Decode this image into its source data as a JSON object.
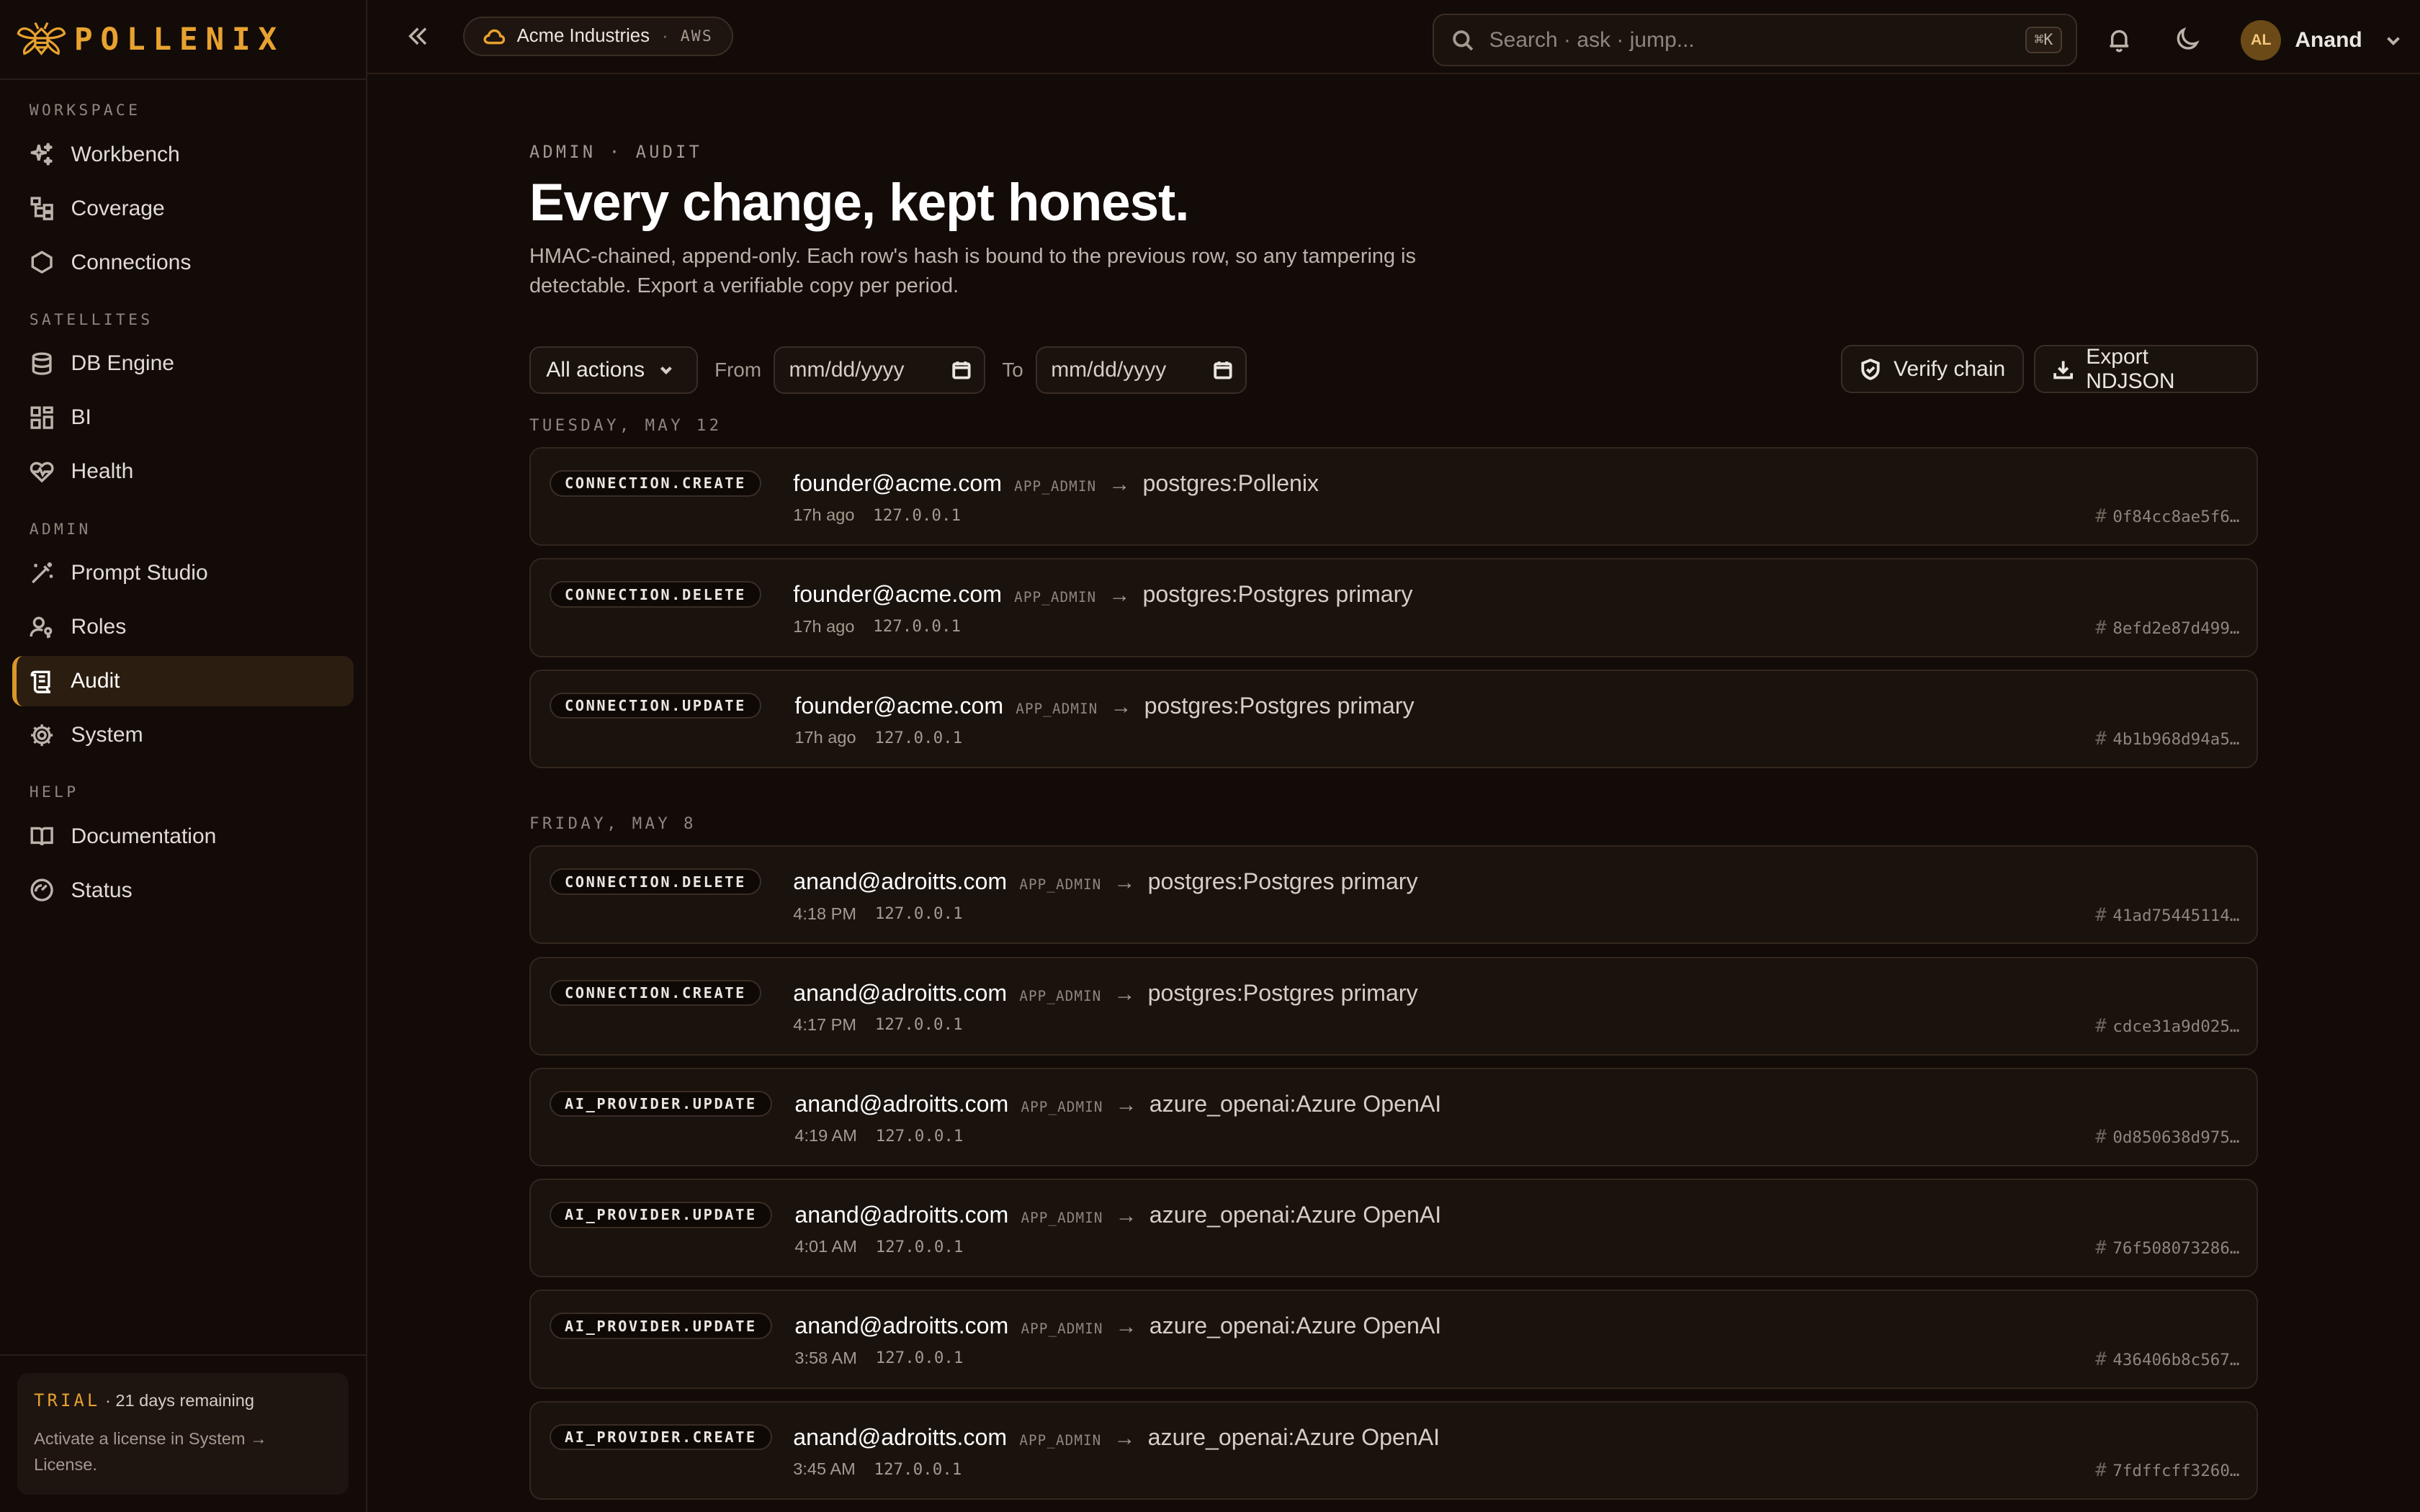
{
  "brand": {
    "name": "POLLENIX",
    "color": "#e8a230"
  },
  "sidebar": {
    "sections": [
      {
        "title": "WORKSPACE",
        "items": [
          {
            "label": "Workbench",
            "icon": "sparkles-icon"
          },
          {
            "label": "Coverage",
            "icon": "tree-icon"
          },
          {
            "label": "Connections",
            "icon": "hexagon-icon"
          }
        ]
      },
      {
        "title": "SATELLITES",
        "items": [
          {
            "label": "DB Engine",
            "icon": "database-icon"
          },
          {
            "label": "BI",
            "icon": "grid-icon"
          },
          {
            "label": "Health",
            "icon": "heart-pulse-icon"
          }
        ]
      },
      {
        "title": "ADMIN",
        "items": [
          {
            "label": "Prompt Studio",
            "icon": "wand-icon"
          },
          {
            "label": "Roles",
            "icon": "user-key-icon"
          },
          {
            "label": "Audit",
            "icon": "scroll-icon",
            "active": true
          },
          {
            "label": "System",
            "icon": "gear-icon"
          }
        ]
      },
      {
        "title": "HELP",
        "items": [
          {
            "label": "Documentation",
            "icon": "book-icon"
          },
          {
            "label": "Status",
            "icon": "gauge-icon"
          }
        ]
      }
    ],
    "trial": {
      "tag": "TRIAL",
      "remaining": "· 21 days remaining",
      "body": "Activate a license in System → License."
    }
  },
  "topbar": {
    "tenant": {
      "name": "Acme Industries",
      "sep": "·",
      "cloud": "AWS"
    },
    "search": {
      "placeholder": "Search · ask · jump...",
      "shortcut": "⌘K"
    },
    "user": {
      "initials": "AL",
      "name": "Anand"
    }
  },
  "page": {
    "eyebrow": "ADMIN · AUDIT",
    "title": "Every change, kept honest.",
    "description": "HMAC-chained, append-only. Each row's hash is bound to the previous row, so any tampering is detectable. Export a verifiable copy per period."
  },
  "filters": {
    "action": "All actions",
    "from_label": "From",
    "from_placeholder": "mm/dd/yyyy",
    "to_label": "To",
    "to_placeholder": "mm/dd/yyyy",
    "verify": "Verify chain",
    "export": "Export NDJSON"
  },
  "groups": [
    {
      "day": "TUESDAY, MAY 12",
      "rows": [
        {
          "action": "CONNECTION.CREATE",
          "actor": "founder@acme.com",
          "role": "APP_ADMIN",
          "target": "postgres:Pollenix",
          "time": "17h ago",
          "ip": "127.0.0.1",
          "hash": "0f84cc8ae5f6…"
        },
        {
          "action": "CONNECTION.DELETE",
          "actor": "founder@acme.com",
          "role": "APP_ADMIN",
          "target": "postgres:Postgres primary",
          "time": "17h ago",
          "ip": "127.0.0.1",
          "hash": "8efd2e87d499…"
        },
        {
          "action": "CONNECTION.UPDATE",
          "actor": "founder@acme.com",
          "role": "APP_ADMIN",
          "target": "postgres:Postgres primary",
          "time": "17h ago",
          "ip": "127.0.0.1",
          "hash": "4b1b968d94a5…"
        }
      ]
    },
    {
      "day": "FRIDAY, MAY 8",
      "rows": [
        {
          "action": "CONNECTION.DELETE",
          "actor": "anand@adroitts.com",
          "role": "APP_ADMIN",
          "target": "postgres:Postgres primary",
          "time": "4:18 PM",
          "ip": "127.0.0.1",
          "hash": "41ad75445114…"
        },
        {
          "action": "CONNECTION.CREATE",
          "actor": "anand@adroitts.com",
          "role": "APP_ADMIN",
          "target": "postgres:Postgres primary",
          "time": "4:17 PM",
          "ip": "127.0.0.1",
          "hash": "cdce31a9d025…"
        },
        {
          "action": "AI_PROVIDER.UPDATE",
          "actor": "anand@adroitts.com",
          "role": "APP_ADMIN",
          "target": "azure_openai:Azure OpenAI",
          "time": "4:19 AM",
          "ip": "127.0.0.1",
          "hash": "0d850638d975…"
        },
        {
          "action": "AI_PROVIDER.UPDATE",
          "actor": "anand@adroitts.com",
          "role": "APP_ADMIN",
          "target": "azure_openai:Azure OpenAI",
          "time": "4:01 AM",
          "ip": "127.0.0.1",
          "hash": "76f508073286…"
        },
        {
          "action": "AI_PROVIDER.UPDATE",
          "actor": "anand@adroitts.com",
          "role": "APP_ADMIN",
          "target": "azure_openai:Azure OpenAI",
          "time": "3:58 AM",
          "ip": "127.0.0.1",
          "hash": "436406b8c567…"
        },
        {
          "action": "AI_PROVIDER.CREATE",
          "actor": "anand@adroitts.com",
          "role": "APP_ADMIN",
          "target": "azure_openai:Azure OpenAI",
          "time": "3:45 AM",
          "ip": "127.0.0.1",
          "hash": "7fdffcff3260…"
        }
      ]
    }
  ]
}
